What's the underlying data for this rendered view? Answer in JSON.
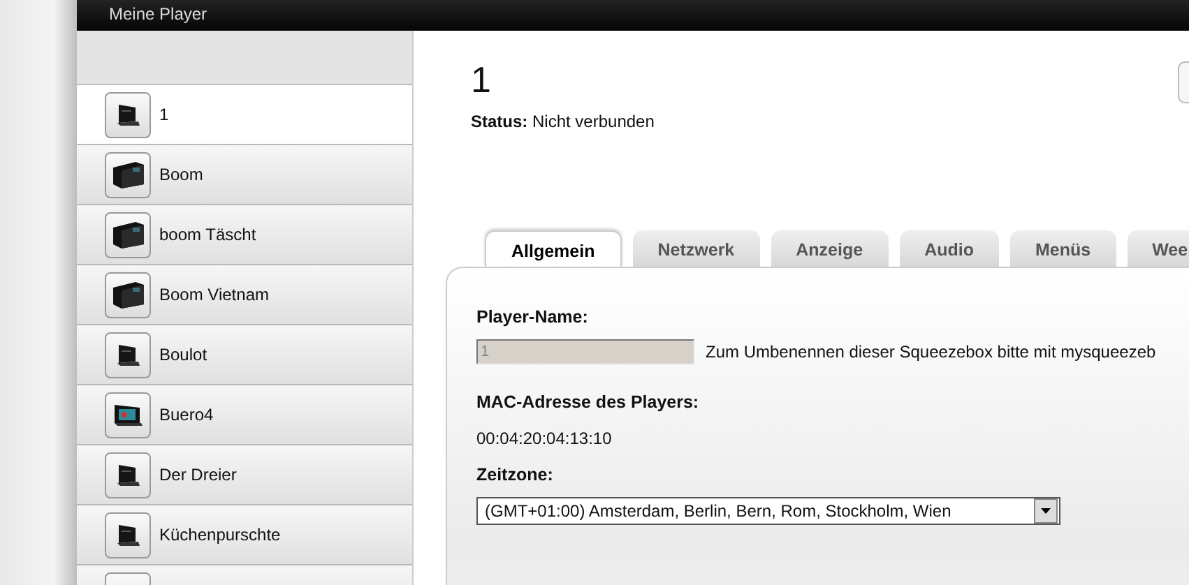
{
  "window": {
    "title": "Meine Player"
  },
  "sidebar": {
    "items": [
      {
        "name": "1",
        "kind": "radio",
        "selected": true
      },
      {
        "name": "Boom",
        "kind": "boom",
        "selected": false
      },
      {
        "name": "boom Täscht",
        "kind": "boom",
        "selected": false
      },
      {
        "name": "Boom Vietnam",
        "kind": "boom",
        "selected": false
      },
      {
        "name": "Boulot",
        "kind": "radio",
        "selected": false
      },
      {
        "name": "Buero4",
        "kind": "touch",
        "selected": false
      },
      {
        "name": "Der Dreier",
        "kind": "radio",
        "selected": false
      },
      {
        "name": "Küchenpurschte",
        "kind": "radio",
        "selected": false
      }
    ]
  },
  "player": {
    "title": "1",
    "status_label": "Status:",
    "status": "Nicht verbunden"
  },
  "tabs": [
    {
      "label": "Allgemein",
      "selected": true
    },
    {
      "label": "Netzwerk",
      "selected": false
    },
    {
      "label": "Anzeige",
      "selected": false
    },
    {
      "label": "Audio",
      "selected": false
    },
    {
      "label": "Menüs",
      "selected": false
    },
    {
      "label": "Wee",
      "selected": false
    }
  ],
  "form": {
    "name_label": "Player-Name:",
    "name_value": "1",
    "name_disabled": true,
    "name_hint": "Zum Umbenennen dieser Squeezebox bitte mit mysqueezeb",
    "mac_label": "MAC-Adresse des Players:",
    "mac_value": "00:04:20:04:13:10",
    "timezone_label": "Zeitzone:",
    "timezone_value": "(GMT+01:00) Amsterdam, Berlin, Bern, Rom, Stockholm, Wien"
  }
}
